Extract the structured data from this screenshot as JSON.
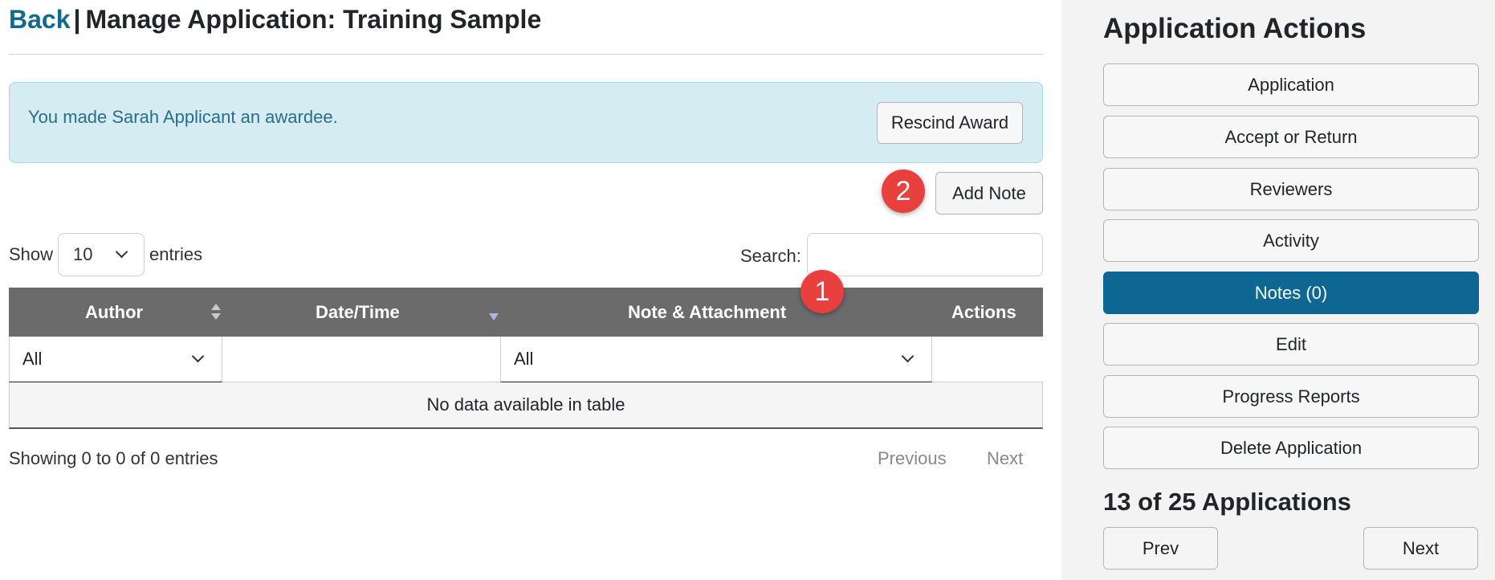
{
  "header": {
    "back_label": "Back",
    "separator": "|",
    "title": "Manage Application: Training Sample"
  },
  "alert": {
    "message": "You made Sarah Applicant an awardee.",
    "rescind_label": "Rescind Award"
  },
  "annotations": {
    "marker_1": "1",
    "marker_2": "2",
    "marker_color": "#e8403f"
  },
  "notes_toolbar": {
    "add_note_label": "Add Note"
  },
  "table_controls": {
    "show_label": "Show",
    "entries_value": "10",
    "entries_label": "entries",
    "search_label": "Search:",
    "search_value": ""
  },
  "table": {
    "columns": [
      "Author",
      "Date/Time",
      "Note & Attachment",
      "Actions"
    ],
    "sort": {
      "Author": "both",
      "Date/Time": "descending"
    },
    "filters": {
      "author": "All",
      "date": "",
      "note": "All"
    },
    "empty_message": "No data available in table",
    "info": "Showing 0 to 0 of 0 entries",
    "pager": {
      "previous": "Previous",
      "next": "Next"
    }
  },
  "sidebar": {
    "title": "Application Actions",
    "actions": [
      {
        "label": "Application",
        "active": false
      },
      {
        "label": "Accept or Return",
        "active": false
      },
      {
        "label": "Reviewers",
        "active": false
      },
      {
        "label": "Activity",
        "active": false
      },
      {
        "label": "Notes (0)",
        "active": true
      },
      {
        "label": "Edit",
        "active": false
      },
      {
        "label": "Progress Reports",
        "active": false
      },
      {
        "label": "Delete Application",
        "active": false
      }
    ],
    "count_text": "13 of 25 Applications",
    "prev_label": "Prev",
    "next_label": "Next",
    "accent_color": "#0e6792"
  }
}
